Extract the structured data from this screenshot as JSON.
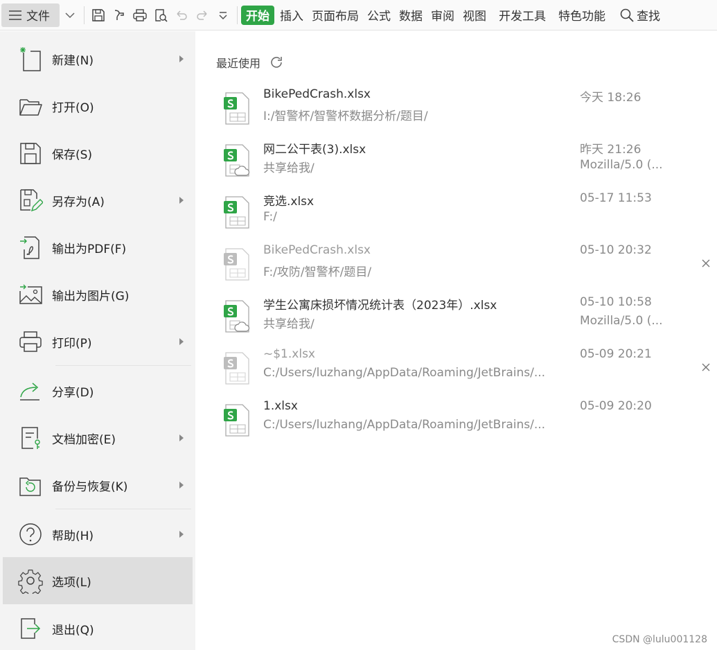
{
  "toolbar": {
    "file_label": "文件",
    "tabs": [
      "开始",
      "插入",
      "页面布局",
      "公式",
      "数据",
      "审阅",
      "视图",
      "开发工具",
      "特色功能"
    ],
    "search_label": "查找"
  },
  "menu": {
    "items": [
      {
        "label": "新建(N)",
        "icon": "new-file-icon",
        "arrow": true
      },
      {
        "label": "打开(O)",
        "icon": "folder-open-icon",
        "arrow": false
      },
      {
        "label": "保存(S)",
        "icon": "save-icon",
        "arrow": false
      },
      {
        "label": "另存为(A)",
        "icon": "save-as-icon",
        "arrow": true
      },
      {
        "label": "输出为PDF(F)",
        "icon": "export-pdf-icon",
        "arrow": false
      },
      {
        "label": "输出为图片(G)",
        "icon": "export-image-icon",
        "arrow": false
      },
      {
        "label": "打印(P)",
        "icon": "print-icon",
        "arrow": true
      },
      {
        "label": "分享(D)",
        "icon": "share-icon",
        "arrow": false
      },
      {
        "label": "文档加密(E)",
        "icon": "encrypt-icon",
        "arrow": true
      },
      {
        "label": "备份与恢复(K)",
        "icon": "backup-icon",
        "arrow": true
      },
      {
        "label": "帮助(H)",
        "icon": "help-icon",
        "arrow": true
      },
      {
        "label": "选项(L)",
        "icon": "gear-icon",
        "arrow": false,
        "selected": true
      },
      {
        "label": "退出(Q)",
        "icon": "exit-icon",
        "arrow": false
      }
    ]
  },
  "recent": {
    "title": "最近使用",
    "files": [
      {
        "name": "BikePedCrash.xlsx",
        "path": "I:/智警杯/智警杯数据分析/题目/",
        "time": "今天 18:26",
        "extra": "",
        "cloud": false,
        "dim": false,
        "closable": false
      },
      {
        "name": "网二公干表(3).xlsx",
        "path": "共享给我/",
        "time": "昨天 21:26",
        "extra": "Mozilla/5.0 (...",
        "cloud": true,
        "dim": false,
        "closable": false
      },
      {
        "name": "竞选.xlsx",
        "path": "F:/",
        "time": "05-17 11:53",
        "extra": "",
        "cloud": false,
        "dim": false,
        "closable": false
      },
      {
        "name": "BikePedCrash.xlsx",
        "path": "F:/攻防/智警杯/题目/",
        "time": "05-10 20:32",
        "extra": "",
        "cloud": false,
        "dim": true,
        "closable": true
      },
      {
        "name": "学生公寓床损坏情况统计表（2023年）.xlsx",
        "path": "共享给我/",
        "time": "05-10 10:58",
        "extra": "Mozilla/5.0 (...",
        "cloud": true,
        "dim": false,
        "closable": false
      },
      {
        "name": "~$1.xlsx",
        "path": "C:/Users/luzhang/AppData/Roaming/JetBrains/...",
        "time": "05-09 20:21",
        "extra": "",
        "cloud": false,
        "dim": true,
        "closable": true
      },
      {
        "name": "1.xlsx",
        "path": "C:/Users/luzhang/AppData/Roaming/JetBrains/...",
        "time": "05-09 20:20",
        "extra": "",
        "cloud": false,
        "dim": false,
        "closable": false
      }
    ]
  },
  "watermark": "CSDN @lulu001128",
  "colors": {
    "accent": "#2fa547",
    "menu_bg": "#f3f3f3",
    "selected_bg": "#dedede"
  }
}
